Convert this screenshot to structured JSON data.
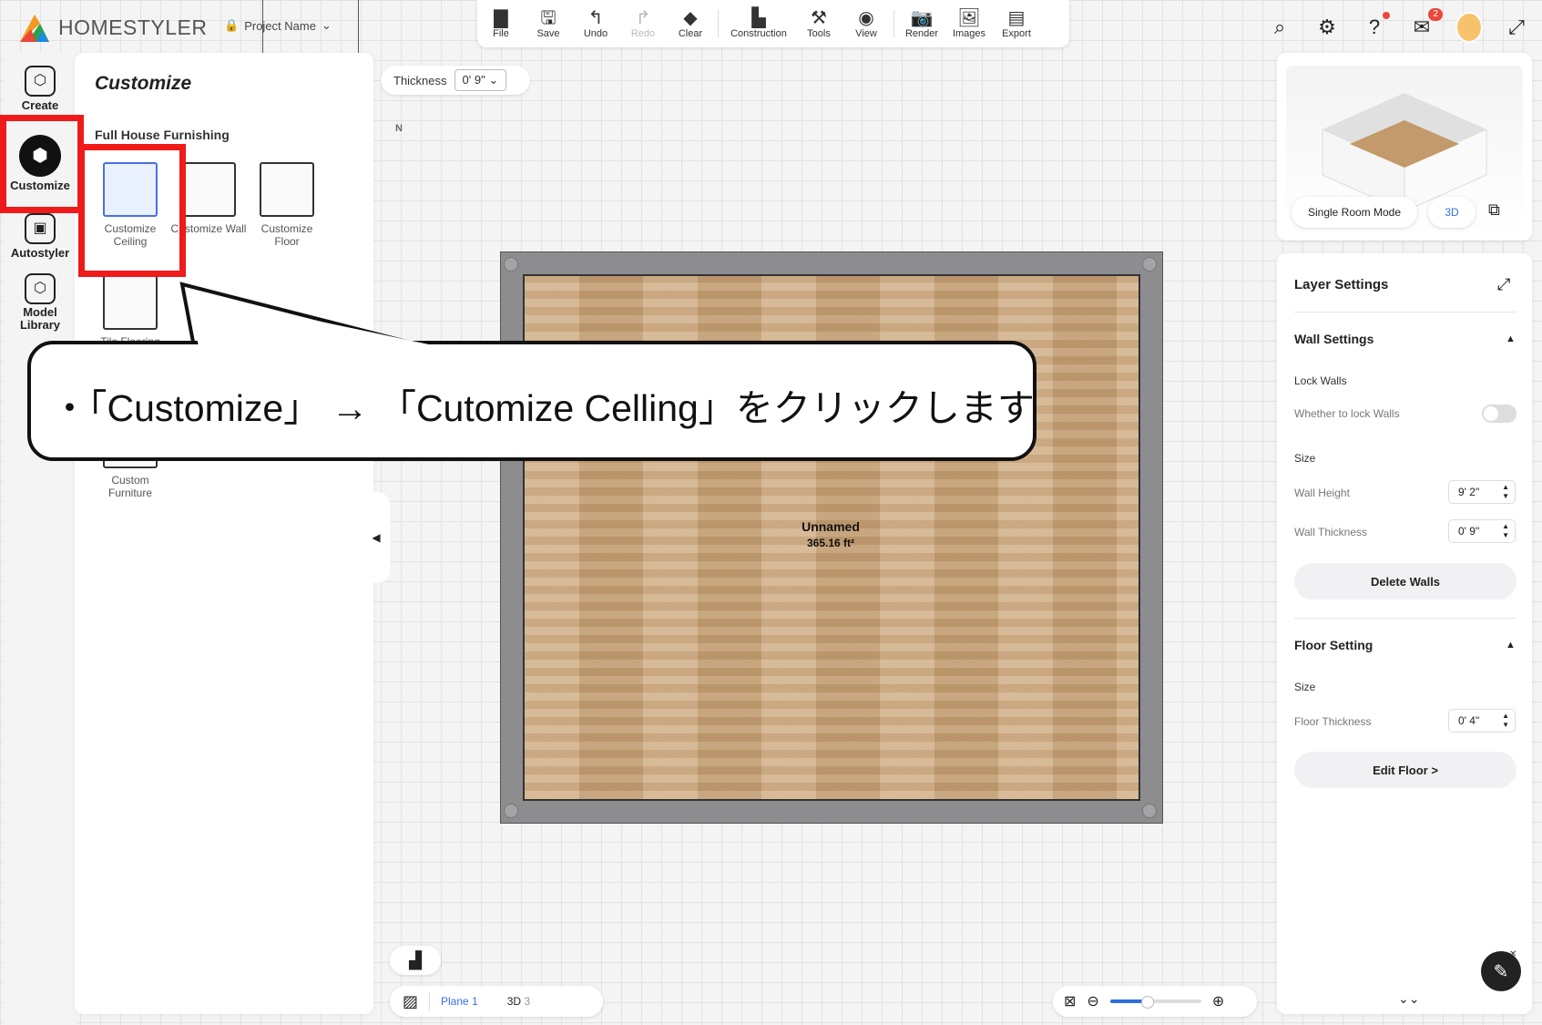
{
  "app": {
    "logo_text": "HOMESTYLER",
    "project_name": "Project Name"
  },
  "toolbar": {
    "items": [
      {
        "label": "File",
        "icon": "folder-icon"
      },
      {
        "label": "Save",
        "icon": "save-icon"
      },
      {
        "label": "Undo",
        "icon": "undo-icon"
      },
      {
        "label": "Redo",
        "icon": "redo-icon"
      },
      {
        "label": "Clear",
        "icon": "eraser-icon"
      },
      {
        "label": "Construction",
        "icon": "construction-icon"
      },
      {
        "label": "Tools",
        "icon": "tools-icon"
      },
      {
        "label": "View",
        "icon": "eye-icon"
      },
      {
        "label": "Render",
        "icon": "camera-icon"
      },
      {
        "label": "Images",
        "icon": "images-icon"
      },
      {
        "label": "Export",
        "icon": "export-icon"
      }
    ]
  },
  "rail": {
    "items": [
      {
        "label": "Create",
        "icon": "create-icon"
      },
      {
        "label": "Customize",
        "icon": "customize-icon"
      },
      {
        "label": "Autostyler",
        "icon": "autostyler-icon"
      },
      {
        "label": "Model Library",
        "icon": "model-library-icon"
      }
    ]
  },
  "panel": {
    "title": "Customize",
    "section": "Full House Furnishing",
    "tiles": [
      {
        "label": "Customize Ceiling"
      },
      {
        "label": "Customize Wall"
      },
      {
        "label": "Customize Floor"
      },
      {
        "label": "Tile Flooring"
      },
      {
        "label": "Custom Furniture"
      }
    ]
  },
  "canvas": {
    "thickness_label": "Thickness",
    "thickness_value": "0' 9\"",
    "compass": "N",
    "room_name": "Unnamed",
    "room_area": "365.16 ft²"
  },
  "callout": {
    "text": "・「Customize」 → 「Cutomize Celling」をクリックします"
  },
  "topright": {
    "mail_badge": "2"
  },
  "preview": {
    "single_room_mode": "Single Room Mode",
    "mode_3d": "3D"
  },
  "layer_settings": {
    "title": "Layer Settings",
    "wall_settings": "Wall Settings",
    "lock_walls": "Lock Walls",
    "lock_walls_desc": "Whether to lock Walls",
    "lock_walls_on": false,
    "size": "Size",
    "wall_height_label": "Wall Height",
    "wall_height": "9' 2\"",
    "wall_thickness_label": "Wall Thickness",
    "wall_thickness": "0' 9\"",
    "delete_walls": "Delete Walls",
    "floor_setting": "Floor Setting",
    "floor_size": "Size",
    "floor_thickness_label": "Floor Thickness",
    "floor_thickness": "0' 4\"",
    "edit_floor": "Edit Floor >"
  },
  "bottom": {
    "plane_label": "Plane",
    "plane_count": "1",
    "view3d_label": "3D",
    "view3d_count": "3",
    "zoom_level": 0.4
  },
  "colors": {
    "highlight": "#ef1a1a",
    "accent": "#2f6fe0"
  }
}
